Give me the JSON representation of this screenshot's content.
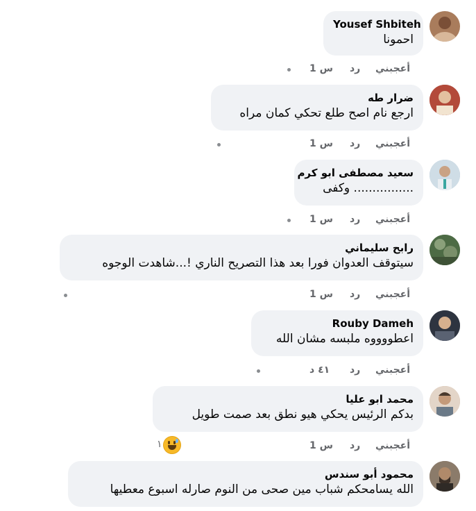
{
  "actions": {
    "like": "أعجبني",
    "reply": "رد"
  },
  "comments": [
    {
      "author": "Yousef Shbiteh",
      "text": "احمونا",
      "time": "1 س",
      "avatar_color": "#a97c5c"
    },
    {
      "author": "ضرار طه",
      "text": "ارجع نام اصح طلع تحكي كمان مراه",
      "time": "1 س",
      "avatar_color": "#8a3a2e"
    },
    {
      "author": "سعيد مصطفى ابو كرم",
      "text": "................ وكفى",
      "time": "1 س",
      "avatar_color": "#9fb7c8"
    },
    {
      "author": "رابح سليماني",
      "text": "سيتوقف العدوان فورا بعد هذا التصريح الناري !...شاهدت الوجوه",
      "time": "1 س",
      "avatar_color": "#5f7d55"
    },
    {
      "author": "Rouby Dameh",
      "text": "اعطووووه ملبسه مشان الله",
      "time": "٤١ د",
      "avatar_color": "#3d4452"
    },
    {
      "author": "محمد ابو عليا",
      "text": "بدكم الرئيس يحكي هيو نطق بعد صمت طويل",
      "time": "1 س",
      "avatar_color": "#c49a7a"
    },
    {
      "author": "محمود أبو سندس",
      "text": "الله يسامحكم شباب مين صحى من النوم صارله اسبوع معطيها",
      "avatar_color": "#6a5a4c"
    }
  ],
  "reaction": {
    "icon": "grinning-sweat-emoji-icon",
    "count": "١"
  },
  "colors": {
    "bubble": "#f0f2f5",
    "meta": "#65676b",
    "text": "#050505"
  }
}
